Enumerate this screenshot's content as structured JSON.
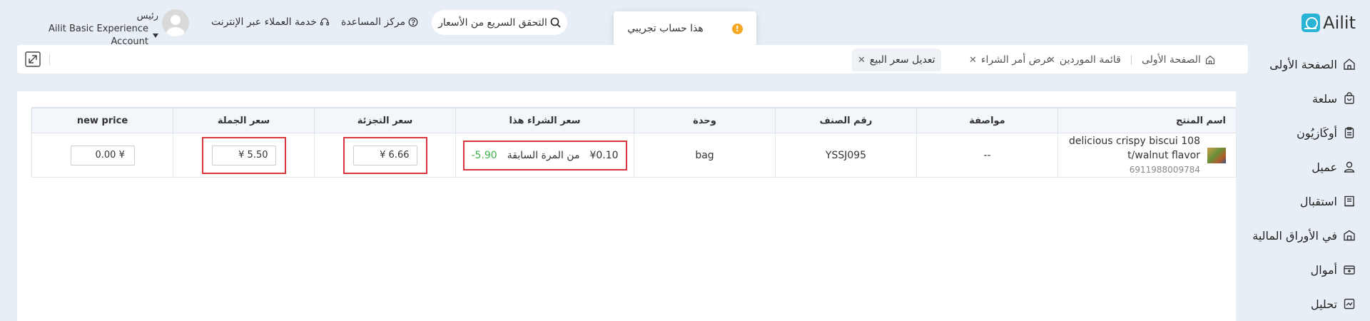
{
  "app": {
    "logo_text": "Ailit"
  },
  "sidebar": {
    "items": [
      {
        "label": "الصفحة الأولى",
        "icon": "home-icon"
      },
      {
        "label": "سلعة",
        "icon": "bag-icon"
      },
      {
        "label": "أوكَازيُون",
        "icon": "clipboard-icon"
      },
      {
        "label": "عميل",
        "icon": "user-icon"
      },
      {
        "label": "استقبال",
        "icon": "inbox-icon"
      },
      {
        "label": "في الأوراق المالية",
        "icon": "warehouse-icon"
      },
      {
        "label": "أموال",
        "icon": "wallet-icon"
      },
      {
        "label": "تحليل",
        "icon": "chart-icon"
      }
    ]
  },
  "topbar": {
    "price_check_label": "التحقق السريع من الأسعار",
    "help_center_label": "مركز المساعدة",
    "online_support_label": "خدمة العملاء عبر الإنترنت",
    "user_role": "رئيس",
    "user_account": "Ailit Basic Experience Account"
  },
  "toast": {
    "message": "هذا حساب تجريبي",
    "icon_text": "!"
  },
  "tabs": [
    {
      "label": "الصفحة الأولى",
      "closable": false
    },
    {
      "label": "قائمة الموردين",
      "closable": true
    },
    {
      "label": "عرض أمر الشراء",
      "closable": true
    },
    {
      "label": "تعديل سعر البيع",
      "closable": true,
      "active": true
    }
  ],
  "table": {
    "headers": {
      "product_name": "اسم المنتج",
      "spec": "مواصفة",
      "item_no": "رقم الصنف",
      "unit": "وحدة",
      "purchase_price": "سعر الشراء هذا",
      "retail_price": "سعر التجزئة",
      "wholesale_price": "سعر الجملة",
      "new_price": "new price"
    },
    "rows": [
      {
        "product_name": "delicious crispy biscui 108 t/walnut flavor",
        "barcode": "6911988009784",
        "spec": "--",
        "item_no": "YSSJ095",
        "unit": "bag",
        "purchase_now": "¥0.10",
        "purchase_prev_label": "من المرة السابقة",
        "purchase_diff": "-5.90",
        "retail_price": "¥ 6.66",
        "wholesale_price": "¥ 5.50",
        "new_price": "¥ 0.00"
      }
    ]
  },
  "colors": {
    "highlight_border": "#d9363e",
    "diff_green": "#3db44a",
    "logo_blue": "#29b3d4",
    "toast_warn": "#f5a623"
  }
}
